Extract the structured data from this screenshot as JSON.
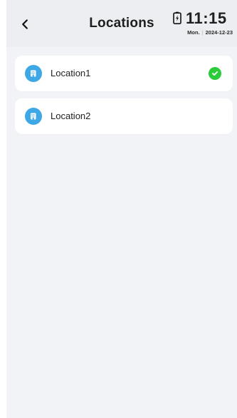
{
  "header": {
    "title": "Locations"
  },
  "status": {
    "time": "11:15",
    "day": "Mon.",
    "date": "2024-12-23",
    "separator": "|"
  },
  "locations": [
    {
      "name": "Location1",
      "selected": true
    },
    {
      "name": "Location2",
      "selected": false
    }
  ],
  "icons": {
    "back": "chevron-left-icon",
    "battery": "battery-charging-icon",
    "location": "building-icon",
    "selected": "check-circle-icon"
  },
  "colors": {
    "header_bg": "#eceef1",
    "page_bg": "#f1f3f6",
    "item_icon_bg": "#3ea7e6",
    "selected_check": "#2bcc3b"
  }
}
